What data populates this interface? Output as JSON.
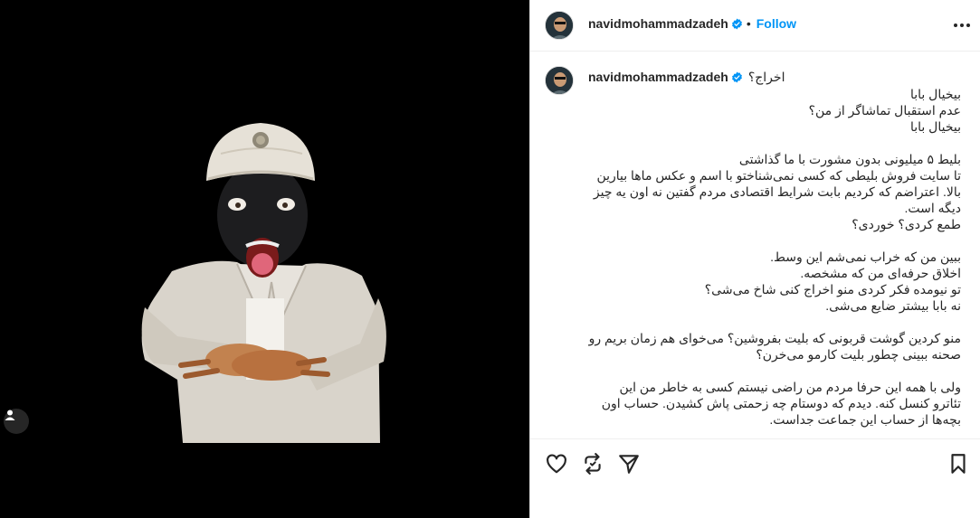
{
  "post": {
    "username": "navidmohammadzadeh",
    "follow_label": "Follow",
    "dot_separator": "•",
    "caption_first_line": "اخراج؟",
    "caption_body": "بیخیال بابا\nعدم استقبال تماشاگر از من؟\nبیخیال بابا\n\nبلیط ۵ میلیونی بدون مشورت با ما گذاشتی\nتا سایت فروش بلیطی که کسی نمی‌شناختو با اسم و عکس ماها بیارین بالا. اعتراضم که کردیم بابت شرایط اقتصادی مردم گفتین نه اون یه چیز دیگه است.\nطمع کردی؟ خوردی؟\n\nببین من که خراب نمی‌شم این وسط.\nاخلاق حرفه‌ای من که مشخصه.\nتو نیومده فکر کردی منو اخراج کنی شاخ می‌شی؟\nنه بابا بیشتر ضایع می‌شی.\n\nمنو کردین گوشت قربونی که بلیت بفروشین؟ می‌خوای هم زمان بریم رو صحنه ببینی چطور بلیت کارمو می‌خرن؟\n\nولی با همه این حرفا مردم من راضی نیستم کسی به خاطر من این تئاترو کنسل کنه. دیدم که دوستام چه زحمتی پاش کشیدن. حساب اون بچه‌ها از حساب این جماعت جداست."
  },
  "icons": {
    "verified": "verified-badge-icon",
    "more": "more-options-icon",
    "like": "heart-icon",
    "repost": "repost-icon",
    "share": "send-icon",
    "save": "bookmark-icon",
    "tag": "user-tag-icon"
  },
  "colors": {
    "link_blue": "#0095f6",
    "verified_blue": "#0095f6",
    "media_background": "#000000"
  }
}
